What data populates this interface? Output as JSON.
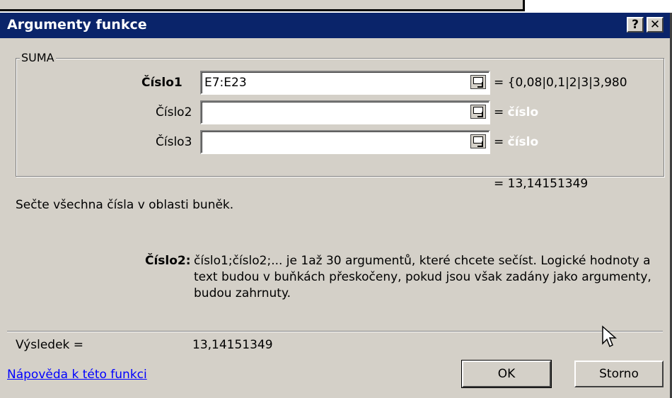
{
  "dialog": {
    "title": "Argumenty funkce",
    "help_button": "?",
    "close_button": "✕"
  },
  "function_group": {
    "label": "SUMA",
    "args": [
      {
        "label": "Číslo1",
        "value": "E7:E23",
        "result": "= {0,08|0,1|2|3|3,980"
      },
      {
        "label": "Číslo2",
        "value": "",
        "result": "číslo"
      },
      {
        "label": "Číslo3",
        "value": "",
        "result": "číslo"
      }
    ]
  },
  "total_result": "= 13,14151349",
  "description": "Sečte všechna čísla v oblasti buněk.",
  "arg_help": {
    "name": "Číslo2:",
    "text": "číslo1;číslo2;... je 1až 30 argumentů, které chcete sečíst. Logické hodnoty a text budou v buňkách přeskočeny, pokud jsou však zadány jako argumenty, budou zahrnuty."
  },
  "result_row": {
    "label": "Výsledek =",
    "value": "13,14151349"
  },
  "help_link": "Nápověda k této funkci",
  "buttons": {
    "ok": "OK",
    "cancel": "Storno"
  },
  "colors": {
    "titlebar": "#0a246a",
    "face": "#d4d0c8",
    "link": "#0000ff"
  }
}
